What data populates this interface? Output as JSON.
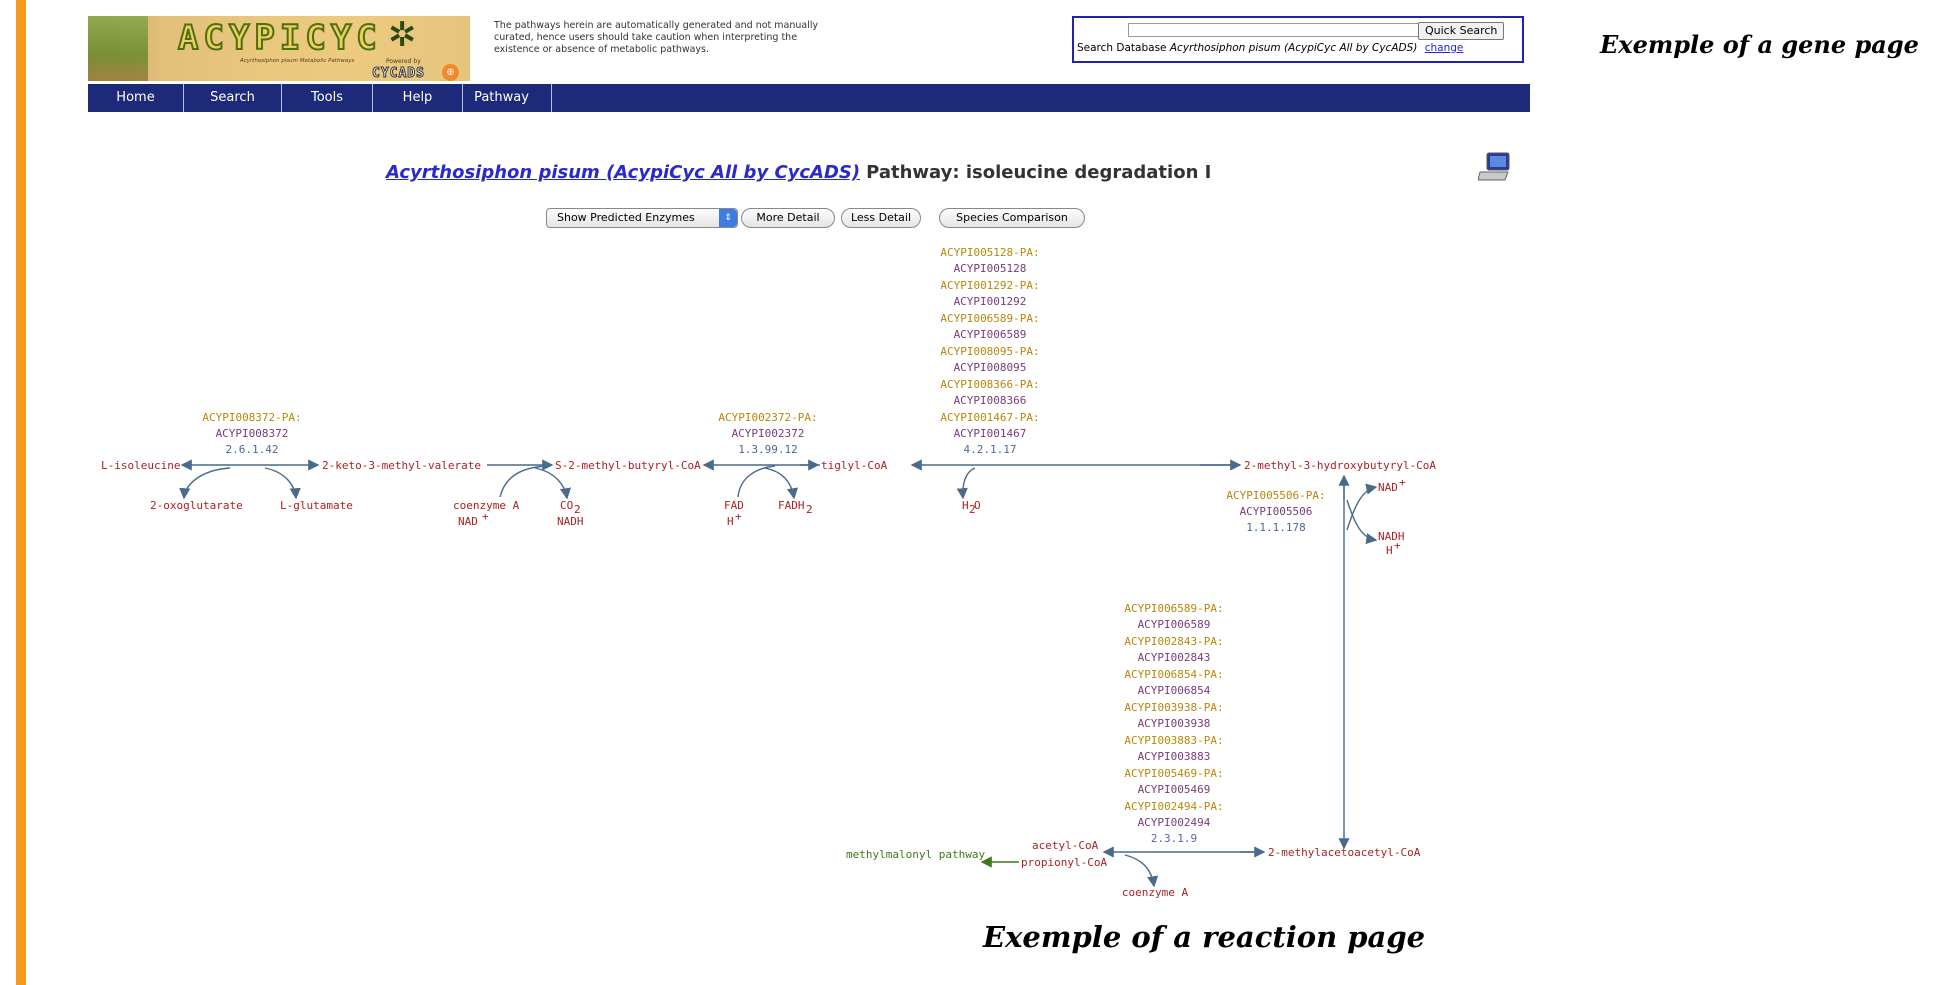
{
  "header": {
    "logo": {
      "wordmark": "ACYPICYC",
      "tagline": "Acyrthosiphon pisum Metabolic Pathways",
      "powered_by": "Powered by",
      "cycads": "CYCADS"
    },
    "disclaimer": "The pathways herein are automatically generated and not manually curated, hence users should take caution when interpreting the existence or absence of metabolic pathways.",
    "search": {
      "input_value": "",
      "button_label": "Quick Search",
      "db_prefix": "Search Database",
      "db_name": "Acyrthosiphon pisum (AcypiCyc All by CycADS)",
      "change_label": "change"
    },
    "nav": [
      "Home",
      "Search",
      "Tools",
      "Help",
      "Pathway"
    ]
  },
  "captions": {
    "gene_page": "Exemple of a gene page",
    "reaction_page": "Exemple of a reaction page"
  },
  "pathway_page": {
    "organism_link": "Acyrthosiphon pisum (AcypiCyc All by CycADS)",
    "title_suffix": "Pathway: isoleucine degradation I",
    "controls": {
      "select_value": "Show Predicted Enzymes",
      "more_detail": "More Detail",
      "less_detail": "Less Detail",
      "species_comparison": "Species Comparison"
    },
    "compounds": {
      "c1": "L-isoleucine",
      "c2": "2-keto-3-methyl-valerate",
      "c3": "S-2-methyl-butyryl-CoA",
      "c4": "tiglyl-CoA",
      "c5": "2-methyl-3-hydroxybutyryl-CoA",
      "c6": "2-methylacetoacetyl-CoA",
      "c7a": "acetyl-CoA",
      "c7b": "propionyl-CoA",
      "c8": "methylmalonyl pathway"
    },
    "side_compounds": {
      "r1_left": "2-oxoglutarate",
      "r1_right": "L-glutamate",
      "r2_in_1": "coenzyme A",
      "r2_in_2": "NAD",
      "r2_out_1": "CO",
      "r2_out_2": "NADH",
      "r3_left_1": "FAD",
      "r3_left_2": "H",
      "r3_right": "FADH",
      "r4_water": "H",
      "r4_water_o": "O",
      "r5_in": "NAD",
      "r5_out_1": "NADH",
      "r5_out_2": "H",
      "r6_out": "coenzyme A"
    },
    "enzymes": {
      "r1": {
        "genes": [
          "ACYPI008372-PA:",
          "ACYPI008372"
        ],
        "ec": "2.6.1.42"
      },
      "r3": {
        "genes": [
          "ACYPI002372-PA:",
          "ACYPI002372"
        ],
        "ec": "1.3.99.12"
      },
      "r4": {
        "genes": [
          "ACYPI005128-PA:",
          "ACYPI005128",
          "ACYPI001292-PA:",
          "ACYPI001292",
          "ACYPI006589-PA:",
          "ACYPI006589",
          "ACYPI008095-PA:",
          "ACYPI008095",
          "ACYPI008366-PA:",
          "ACYPI008366",
          "ACYPI001467-PA:",
          "ACYPI001467"
        ],
        "ec": "4.2.1.17"
      },
      "r5": {
        "genes": [
          "ACYPI005506-PA:",
          "ACYPI005506"
        ],
        "ec": "1.1.1.178"
      },
      "r6": {
        "genes": [
          "ACYPI006589-PA:",
          "ACYPI006589",
          "ACYPI002843-PA:",
          "ACYPI002843",
          "ACYPI006854-PA:",
          "ACYPI006854",
          "ACYPI003938-PA:",
          "ACYPI003938",
          "ACYPI003883-PA:",
          "ACYPI003883",
          "ACYPI005469-PA:",
          "ACYPI005469",
          "ACYPI002494-PA:",
          "ACYPI002494"
        ],
        "ec": "2.3.1.9"
      }
    }
  },
  "colors": {
    "nav_bg": "#1d2a7a",
    "left_bar": "#f39a1e",
    "gene_label": "#b8860b",
    "gene_id": "#7a3a7a",
    "ec_number": "#4a6a9a",
    "compound": "#aa2222",
    "arrow": "#4a6a8a",
    "link_compound": "#3d7a1a"
  },
  "icons": {
    "monitor": "computer-monitor-icon",
    "select_arrow": "up-down-arrow-icon"
  }
}
